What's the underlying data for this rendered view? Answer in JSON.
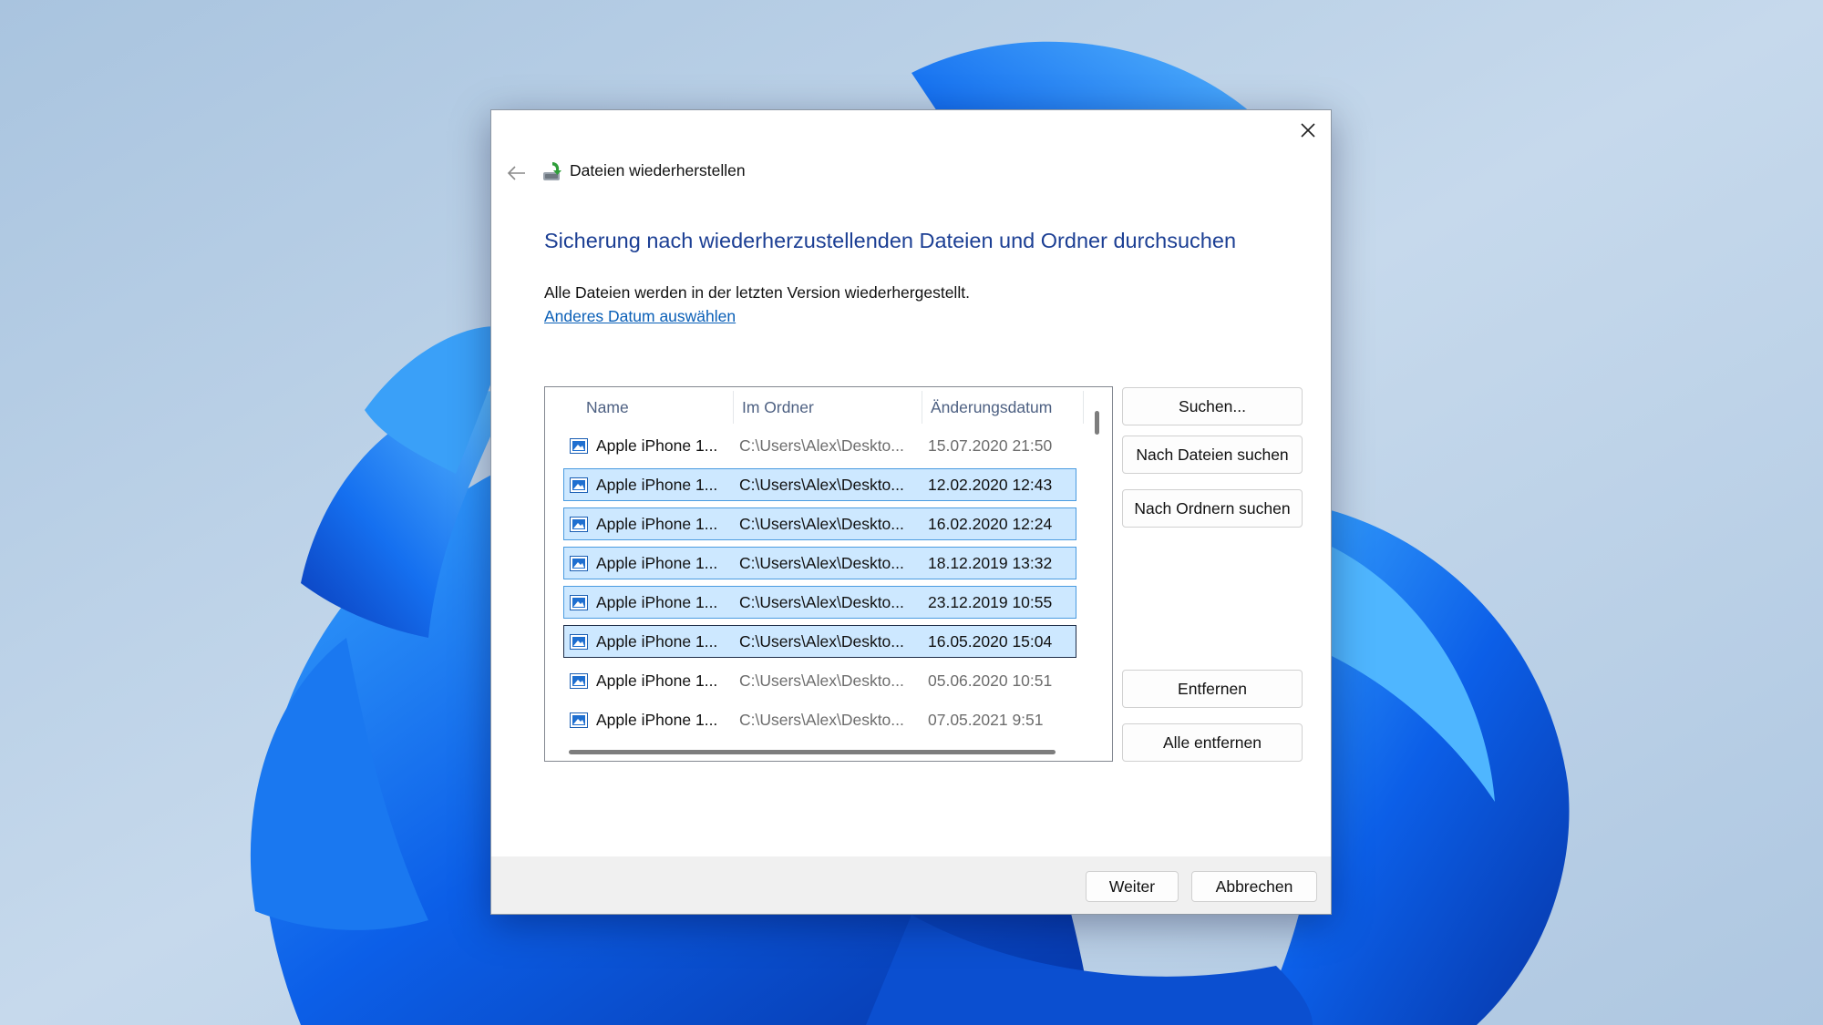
{
  "window": {
    "title": "Dateien wiederherstellen",
    "heading": "Sicherung nach wiederherzustellenden Dateien und Ordner durchsuchen",
    "info_text": "Alle Dateien werden in der letzten Version wiederhergestellt.",
    "date_link": "Anderes Datum auswählen"
  },
  "list": {
    "columns": [
      "Name",
      "Im Ordner",
      "Änderungsdatum"
    ],
    "rows": [
      {
        "name": "Apple iPhone 1...",
        "folder": "C:\\Users\\Alex\\Deskto...",
        "date": "15.07.2020 21:50",
        "state": "normal"
      },
      {
        "name": "Apple iPhone 1...",
        "folder": "C:\\Users\\Alex\\Deskto...",
        "date": "12.02.2020 12:43",
        "state": "selected"
      },
      {
        "name": "Apple iPhone 1...",
        "folder": "C:\\Users\\Alex\\Deskto...",
        "date": "16.02.2020 12:24",
        "state": "selected"
      },
      {
        "name": "Apple iPhone 1...",
        "folder": "C:\\Users\\Alex\\Deskto...",
        "date": "18.12.2019 13:32",
        "state": "selected"
      },
      {
        "name": "Apple iPhone 1...",
        "folder": "C:\\Users\\Alex\\Deskto...",
        "date": "23.12.2019 10:55",
        "state": "selected"
      },
      {
        "name": "Apple iPhone 1...",
        "folder": "C:\\Users\\Alex\\Deskto...",
        "date": "16.05.2020 15:04",
        "state": "focused"
      },
      {
        "name": "Apple iPhone 1...",
        "folder": "C:\\Users\\Alex\\Deskto...",
        "date": "05.06.2020 10:51",
        "state": "normal"
      },
      {
        "name": "Apple iPhone 1...",
        "folder": "C:\\Users\\Alex\\Deskto...",
        "date": "07.05.2021 9:51",
        "state": "normal"
      }
    ]
  },
  "buttons": {
    "search": "Suchen...",
    "search_files": "Nach Dateien suchen",
    "search_folders": "Nach Ordnern suchen",
    "remove": "Entfernen",
    "remove_all": "Alle entfernen",
    "next": "Weiter",
    "cancel": "Abbrechen"
  },
  "icons": {
    "close": "close-icon",
    "back": "back-arrow-icon",
    "app": "restore-files-icon",
    "file": "image-file-icon"
  },
  "colors": {
    "heading": "#1c3f94",
    "link": "#0a5fb7",
    "selection_fill": "#cde8ff",
    "selection_border": "#4a9be0",
    "focus_border": "#1e2d48"
  }
}
